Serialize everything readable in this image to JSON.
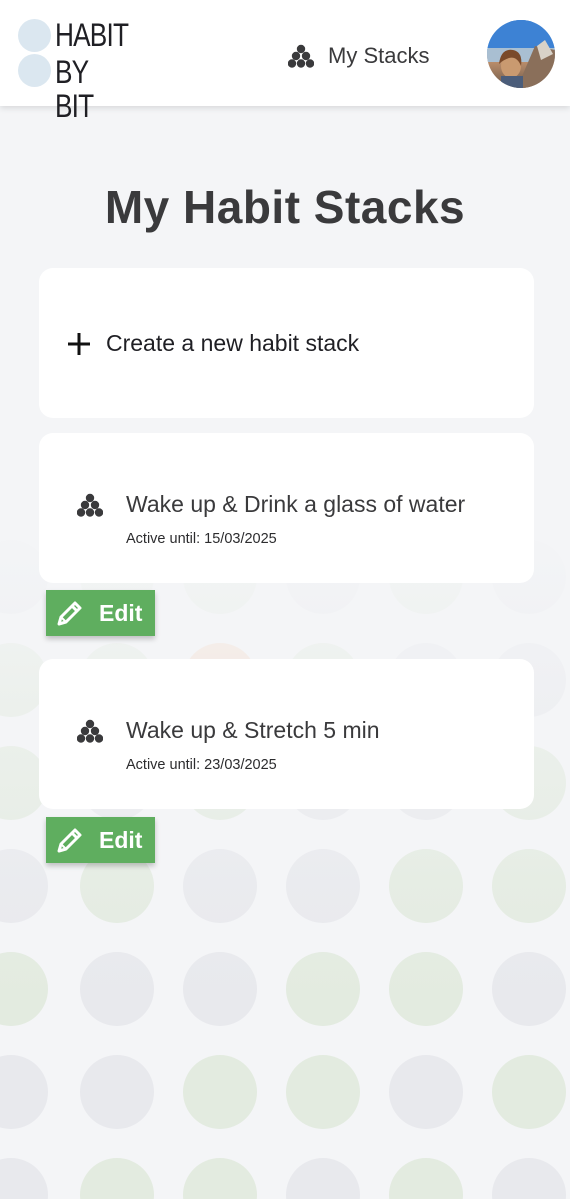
{
  "logo": {
    "line1": "HABIT",
    "line2": "BY BIT"
  },
  "nav": {
    "my_stacks_label": "My Stacks",
    "icon": "stack-icon"
  },
  "page": {
    "title": "My Habit Stacks"
  },
  "create_card": {
    "label": "Create a new habit stack",
    "icon": "plus-icon"
  },
  "stacks": [
    {
      "title": "Wake up & Drink a glass of water",
      "active_until": "Active until: 15/03/2025",
      "edit_label": "Edit"
    },
    {
      "title": "Wake up & Stretch 5 min",
      "active_until": "Active until: 23/03/2025",
      "edit_label": "Edit"
    }
  ],
  "colors": {
    "edit_button": "#5fae5f",
    "background": "#f4f5f7",
    "logo_circle": "#dbe7f0",
    "dot_green": "#e3ebe0",
    "dot_gray": "#e8e9ed",
    "dot_orange": "#f5dccb"
  }
}
